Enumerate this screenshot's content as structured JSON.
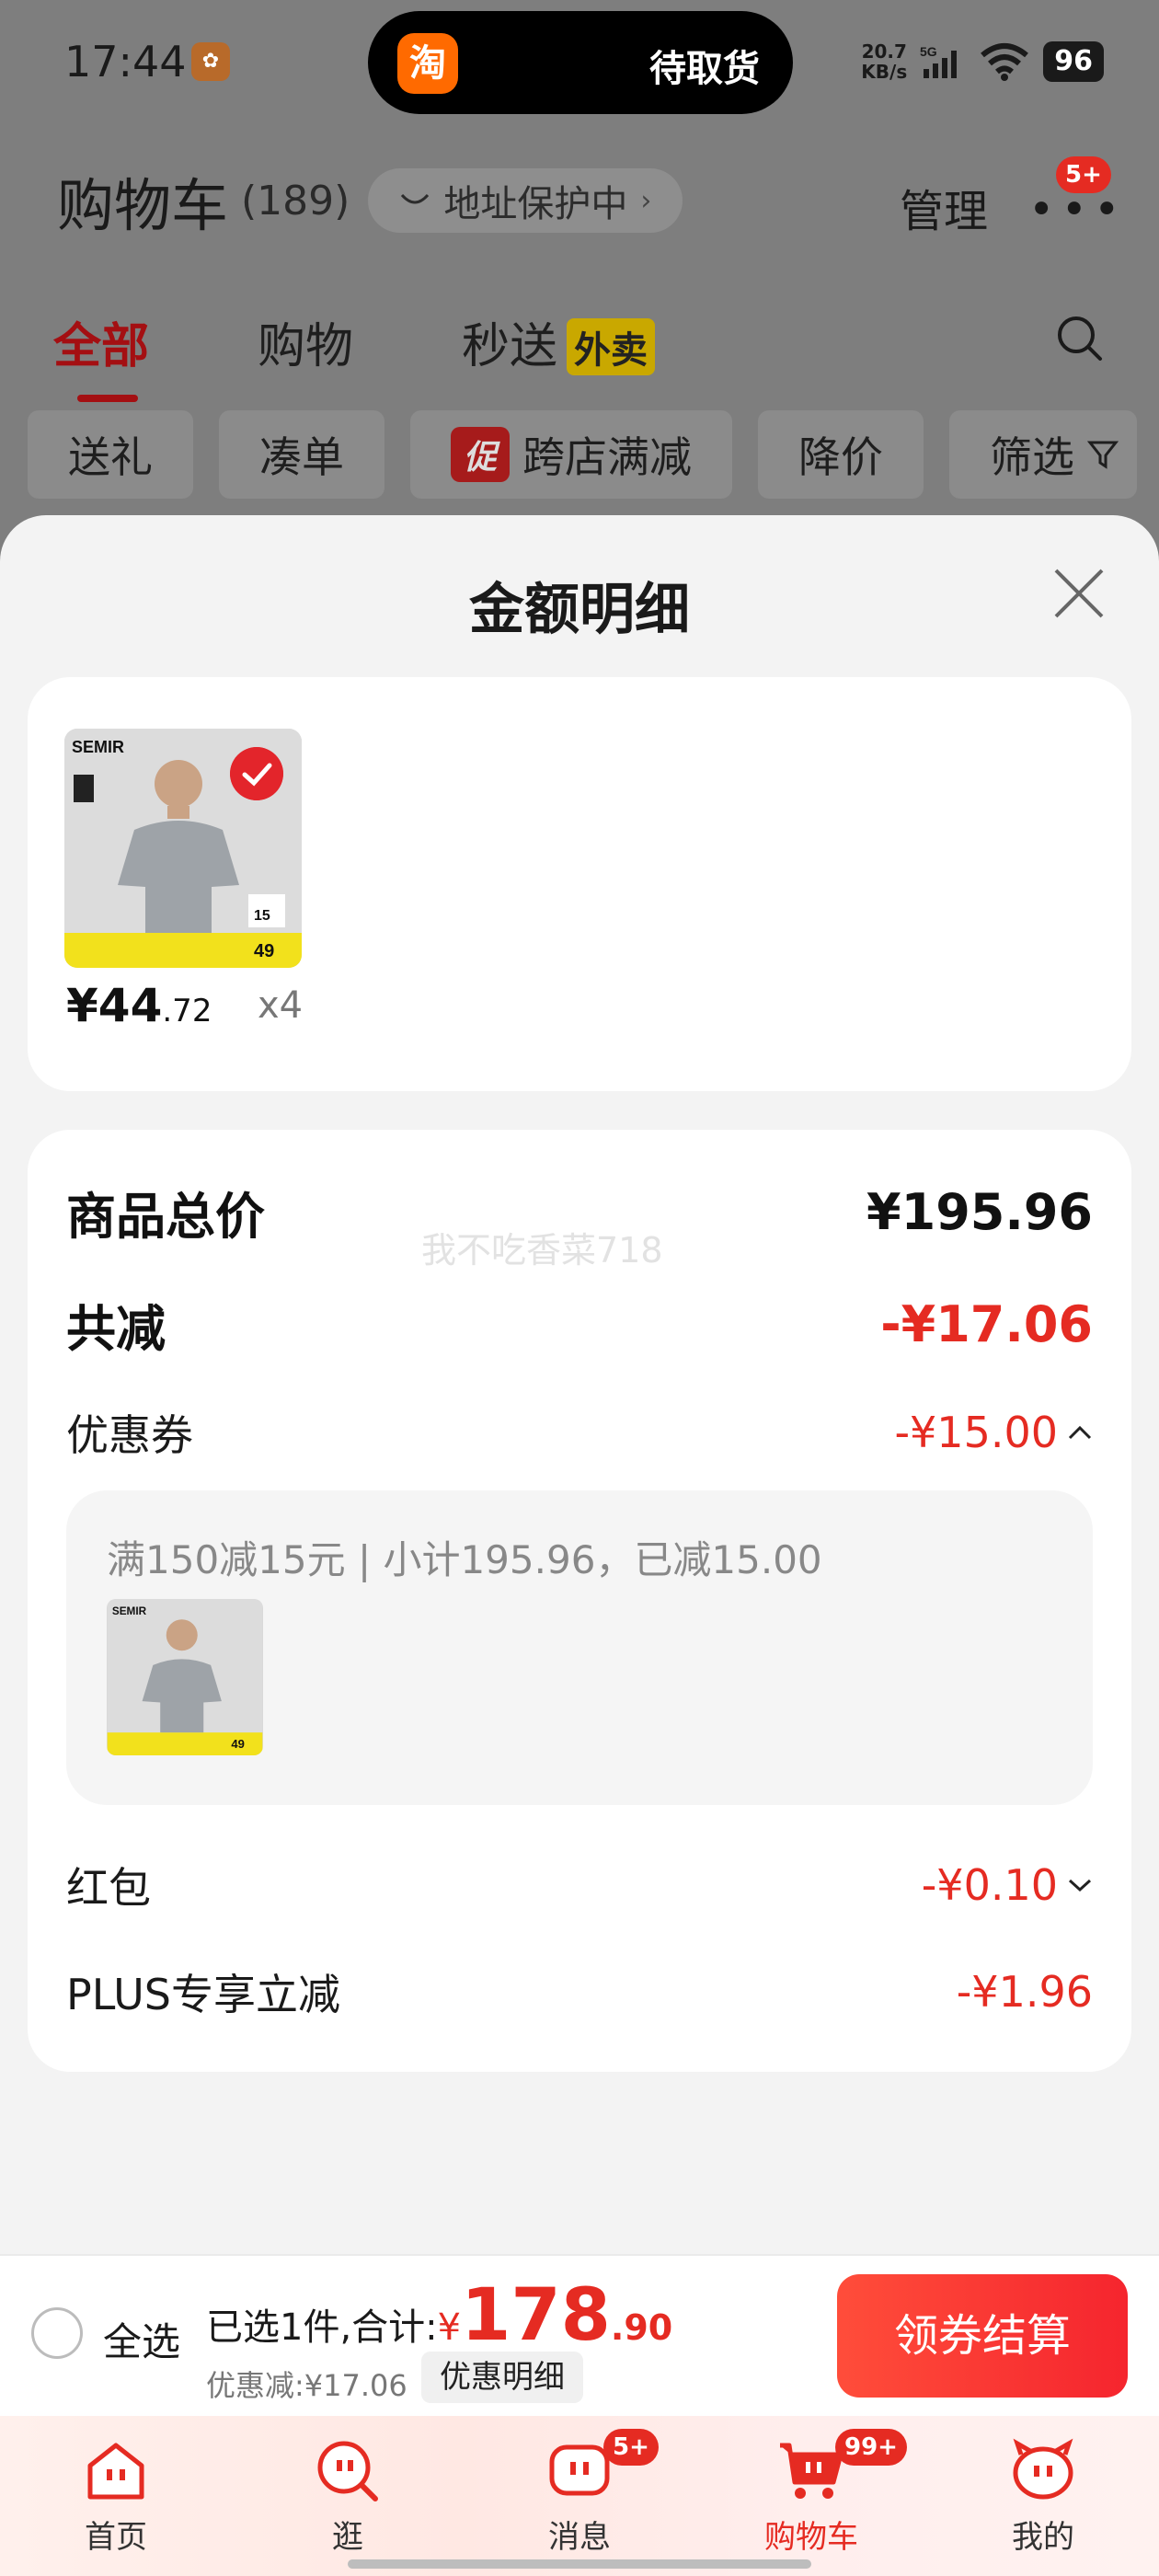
{
  "status_bar": {
    "time": "17:44",
    "island_app_icon": "淘",
    "island_text": "待取货",
    "net_speed_value": "20.7",
    "net_speed_unit": "KB/s",
    "network": "5G",
    "battery": "96"
  },
  "cart_header": {
    "title": "购物车",
    "count": "(189)",
    "address_pill": "地址保护中",
    "manage": "管理",
    "more_badge": "5+"
  },
  "category_tabs": [
    {
      "label": "全部"
    },
    {
      "label": "购物"
    },
    {
      "label": "秒送",
      "tag": "外卖"
    }
  ],
  "filter_chips": [
    {
      "label": "送礼"
    },
    {
      "label": "凑单"
    },
    {
      "label": "跨店满减",
      "tag": "促"
    },
    {
      "label": "降价"
    },
    {
      "label": "筛选"
    }
  ],
  "sheet": {
    "title": "金额明细",
    "product": {
      "price_int": "¥44",
      "price_dec": ".72",
      "quantity": "x4"
    },
    "watermark": "我不吃香菜718",
    "rows": {
      "total_label": "商品总价",
      "total_value": "¥195.96",
      "discount_label": "共减",
      "discount_value": "-¥17.06",
      "coupon_label": "优惠券",
      "coupon_value": "-¥15.00",
      "coupon_detail": "满150减15元 | 小计195.96，已减15.00",
      "redpacket_label": "红包",
      "redpacket_value": "-¥0.10",
      "plus_label": "PLUS专享立减",
      "plus_value": "-¥1.96"
    }
  },
  "checkout": {
    "select_all": "全选",
    "sum_label": "已选1件,合计:",
    "sum_yen": "¥",
    "sum_int": "178",
    "sum_dec": ".90",
    "saved": "优惠减:¥17.06",
    "detail_button": "优惠明细",
    "pay_button": "领券结算"
  },
  "tabbar": [
    {
      "label": "首页",
      "icon": "home-icon"
    },
    {
      "label": "逛",
      "icon": "browse-icon"
    },
    {
      "label": "消息",
      "icon": "message-icon",
      "badge": "5+"
    },
    {
      "label": "购物车",
      "icon": "cart-icon",
      "badge": "99+",
      "active": true
    },
    {
      "label": "我的",
      "icon": "profile-icon"
    }
  ],
  "colors": {
    "accent_red": "#e52b22",
    "tab_active": "#a40f12",
    "overlay_gray": "#7e7e7e"
  }
}
